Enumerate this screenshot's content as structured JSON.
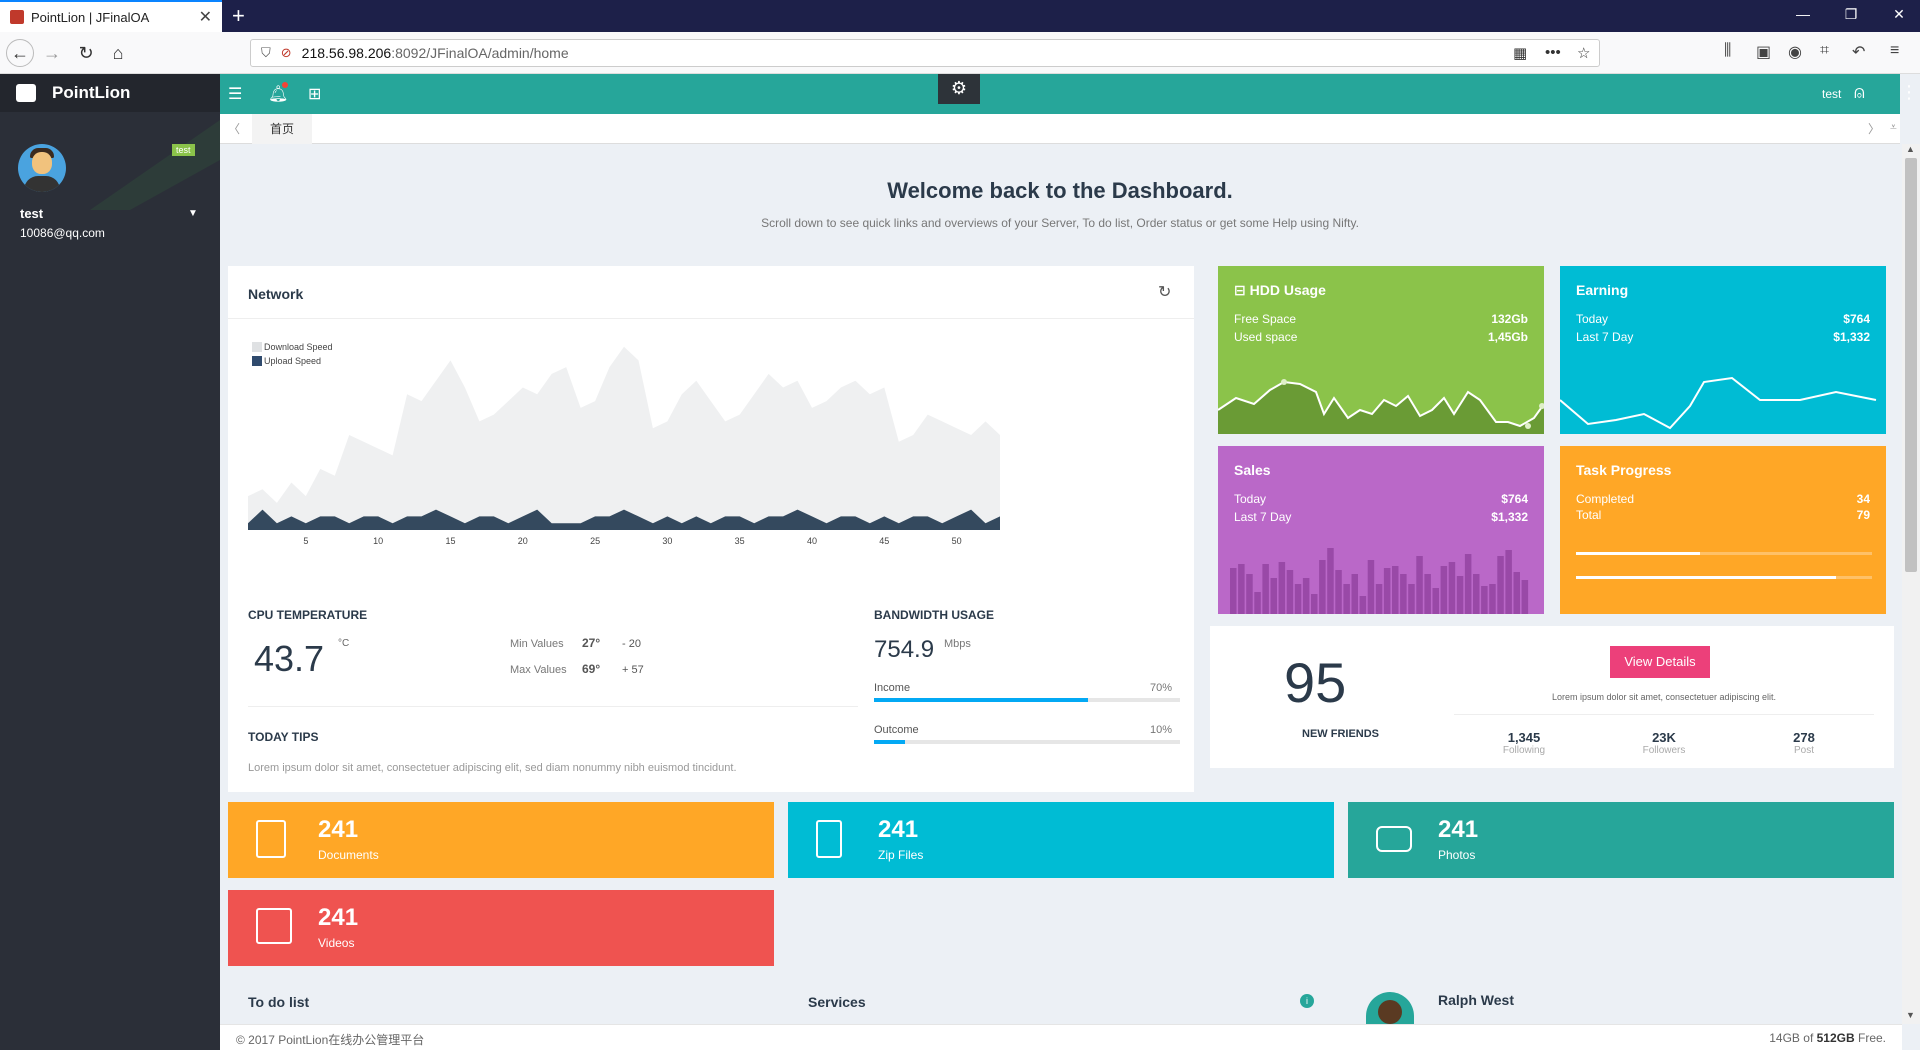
{
  "browser": {
    "tab_title": "PointLion | JFinalOA",
    "url_host": "218.56.98.206",
    "url_path": ":8092/JFinalOA/admin/home"
  },
  "sidebar": {
    "brand": "PointLion",
    "user_badge": "test",
    "user_name": "test",
    "user_email": "10086@qq.com"
  },
  "header": {
    "user": "test"
  },
  "tabs": {
    "home": "首页"
  },
  "welcome": {
    "title": "Welcome back to the Dashboard.",
    "subtitle": "Scroll down to see quick links and overviews of your Server, To do list, Order status or get some Help using Nifty."
  },
  "network": {
    "title": "Network",
    "legend_download": "Download Speed",
    "legend_upload": "Upload Speed",
    "cpu_title": "CPU TEMPERATURE",
    "cpu_value": "43.7",
    "cpu_unit": "°C",
    "min_label": "Min Values",
    "min_value": "27°",
    "min_delta": "- 20",
    "max_label": "Max Values",
    "max_value": "69°",
    "max_delta": "+ 57",
    "bw_title": "BANDWIDTH USAGE",
    "bw_value": "754.9",
    "bw_unit": "Mbps",
    "income_label": "Income",
    "income_pct": "70%",
    "income_fraction": 0.7,
    "outcome_label": "Outcome",
    "outcome_pct": "10%",
    "outcome_fraction": 0.1,
    "tips_title": "TODAY TIPS",
    "tips_text": "Lorem ipsum dolor sit amet, consectetuer adipiscing elit, sed diam nonummy nibh euismod tincidunt."
  },
  "chart_data": {
    "type": "area",
    "x": [
      1,
      2,
      3,
      4,
      5,
      6,
      7,
      8,
      9,
      10,
      11,
      12,
      13,
      14,
      15,
      16,
      17,
      18,
      19,
      20,
      21,
      22,
      23,
      24,
      25,
      26,
      27,
      28,
      29,
      30,
      31,
      32,
      33,
      34,
      35,
      36,
      37,
      38,
      39,
      40,
      41,
      42,
      43,
      44,
      45,
      46,
      47,
      48,
      49,
      50,
      51,
      52,
      53
    ],
    "xticks": [
      5,
      10,
      15,
      20,
      25,
      30,
      35,
      40,
      45,
      50
    ],
    "series": [
      {
        "name": "Download Speed",
        "values": [
          5,
          6,
          4,
          7,
          5,
          9,
          8,
          14,
          13,
          12,
          11,
          20,
          19,
          22,
          25,
          21,
          16,
          17,
          19,
          21,
          20,
          23,
          24,
          18,
          19,
          24,
          27,
          25,
          15,
          16,
          20,
          22,
          19,
          16,
          17,
          20,
          23,
          21,
          22,
          18,
          19,
          21,
          22,
          20,
          21,
          13,
          14,
          17,
          16,
          15,
          14,
          16,
          14
        ]
      },
      {
        "name": "Upload Speed",
        "values": [
          1,
          3,
          1,
          2,
          1,
          2,
          2,
          1,
          2,
          2,
          1,
          2,
          2,
          3,
          2,
          1,
          2,
          2,
          1,
          2,
          3,
          1,
          1,
          1,
          2,
          2,
          3,
          2,
          1,
          2,
          1,
          2,
          1,
          2,
          2,
          1,
          2,
          2,
          3,
          2,
          1,
          2,
          2,
          1,
          2,
          1,
          2,
          2,
          1,
          2,
          3,
          1,
          2
        ]
      }
    ]
  },
  "tiles": {
    "hdd": {
      "title": "HDD Usage",
      "r1_label": "Free Space",
      "r1_value": "132Gb",
      "r2_label": "Used space",
      "r2_value": "1,45Gb"
    },
    "earning": {
      "title": "Earning",
      "r1_label": "Today",
      "r1_value": "$764",
      "r2_label": "Last 7 Day",
      "r2_value": "$1,332"
    },
    "sales": {
      "title": "Sales",
      "r1_label": "Today",
      "r1_value": "$764",
      "r2_label": "Last 7 Day",
      "r2_value": "$1,332"
    },
    "task": {
      "title": "Task Progress",
      "r1_label": "Completed",
      "r1_value": "34",
      "r2_label": "Total",
      "r2_value": "79",
      "bar1": 0.42,
      "bar2": 0.88
    }
  },
  "friends": {
    "count": "95",
    "label": "NEW FRIENDS",
    "button": "View Details",
    "text": "Lorem ipsum dolor sit amet, consectetuer adipiscing elit.",
    "stats": [
      {
        "value": "1,345",
        "label": "Following"
      },
      {
        "value": "23K",
        "label": "Followers"
      },
      {
        "value": "278",
        "label": "Post"
      }
    ]
  },
  "counters": [
    {
      "num": "241",
      "label": "Documents",
      "color": "#ffa726"
    },
    {
      "num": "241",
      "label": "Zip Files",
      "color": "#00bcd4"
    },
    {
      "num": "241",
      "label": "Photos",
      "color": "#26a69a"
    },
    {
      "num": "241",
      "label": "Videos",
      "color": "#ef5350"
    }
  ],
  "bottom": {
    "todo": "To do list",
    "services": "Services",
    "profile_name": "Ralph West"
  },
  "footer": {
    "left": "© 2017 PointLion在线办公管理平台",
    "right_used": "14GB",
    "right_of": " of ",
    "right_total": "512GB",
    "right_free": " Free."
  },
  "colors": {
    "teal": "#26a69a",
    "green": "#8bc34a",
    "cyan": "#00bcd4",
    "purple": "#ba68c8",
    "orange": "#ffa726",
    "pink": "#ec407a",
    "navy": "#34495e"
  }
}
